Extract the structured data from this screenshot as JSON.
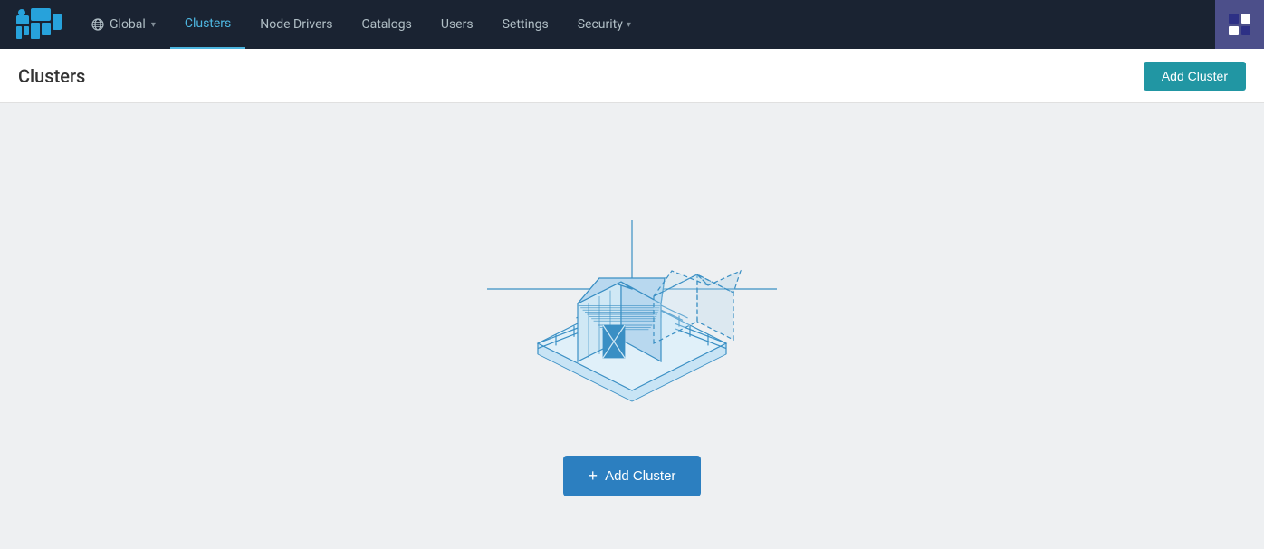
{
  "navbar": {
    "brand_alt": "Rancher",
    "global_label": "Global",
    "nav_items": [
      {
        "id": "clusters",
        "label": "Clusters",
        "active": true
      },
      {
        "id": "node-drivers",
        "label": "Node Drivers",
        "active": false
      },
      {
        "id": "catalogs",
        "label": "Catalogs",
        "active": false
      },
      {
        "id": "users",
        "label": "Users",
        "active": false
      },
      {
        "id": "settings",
        "label": "Settings",
        "active": false
      },
      {
        "id": "security",
        "label": "Security",
        "active": false,
        "has_dropdown": true
      }
    ]
  },
  "page": {
    "title": "Clusters",
    "add_cluster_label": "Add Cluster"
  },
  "empty_state": {
    "add_cluster_label": "Add Cluster",
    "plus_symbol": "+"
  }
}
